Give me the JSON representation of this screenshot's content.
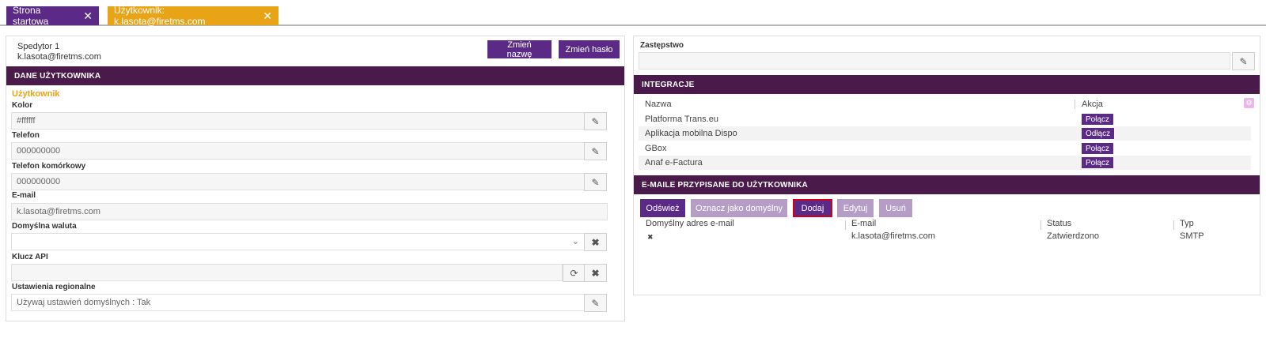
{
  "tabs": [
    {
      "label": "Strona startowa",
      "close": "✕"
    },
    {
      "label": "Użytkownik: k.lasota@firetms.com",
      "close": "✕"
    }
  ],
  "user": {
    "name": "Spedytor 1",
    "email": "k.lasota@firetms.com",
    "rename_label": "Zmień nazwę",
    "password_label": "Zmień hasło"
  },
  "user_data": {
    "header": "DANE UŻYTKOWNIKA",
    "subtitle": "Użytkownik",
    "fields": {
      "color": {
        "label": "Kolor",
        "value": "#ffffff"
      },
      "phone": {
        "label": "Telefon",
        "value": "000000000"
      },
      "mobile": {
        "label": "Telefon komórkowy",
        "value": "000000000"
      },
      "email": {
        "label": "E-mail",
        "value": "k.lasota@firetms.com"
      },
      "currency": {
        "label": "Domyślna waluta",
        "value": ""
      },
      "api_key": {
        "label": "Klucz API",
        "value": ""
      },
      "regional": {
        "label": "Ustawienia regionalne",
        "value": "Używaj ustawień domyślnych : Tak"
      }
    }
  },
  "substitute": {
    "label": "Zastępstwo",
    "value": ""
  },
  "integrations": {
    "header": "INTEGRACJE",
    "col_name": "Nazwa",
    "col_action": "Akcja",
    "rows": [
      {
        "name": "Platforma Trans.eu",
        "action": "Połącz"
      },
      {
        "name": "Aplikacja mobilna Dispo",
        "action": "Odłącz"
      },
      {
        "name": "GBox",
        "action": "Połącz"
      },
      {
        "name": "Anaf e-Factura",
        "action": "Połącz"
      }
    ]
  },
  "emails": {
    "header": "E-MAILE PRZYPISANE DO UŻYTKOWNIKA",
    "buttons": {
      "refresh": "Odśwież",
      "set_default": "Oznacz jako domyślny",
      "add": "Dodaj",
      "edit": "Edytuj",
      "delete": "Usuń"
    },
    "columns": [
      "Domyślny adres e-mail",
      "E-mail",
      "Status",
      "Typ"
    ],
    "rows": [
      {
        "default": "✖",
        "email": "k.lasota@firetms.com",
        "status": "Zatwierdzono",
        "type": "SMTP"
      }
    ]
  },
  "colors": {
    "accent": "#5b2a86",
    "header": "#4a1a4a",
    "highlight": "#e8a317"
  }
}
